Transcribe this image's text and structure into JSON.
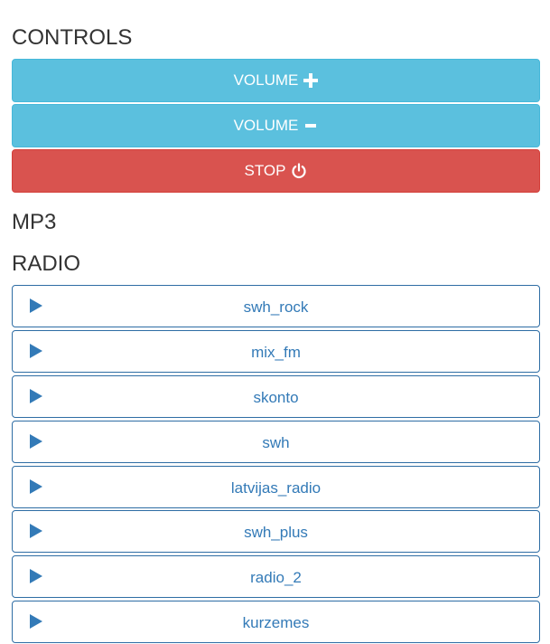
{
  "controls": {
    "heading": "CONTROLS",
    "volume_up_label": "VOLUME",
    "volume_down_label": "VOLUME",
    "stop_label": "STOP"
  },
  "mp3": {
    "heading": "MP3"
  },
  "radio": {
    "heading": "RADIO",
    "stations": [
      "swh_rock",
      "mix_fm",
      "skonto",
      "swh",
      "latvijas_radio",
      "swh_plus",
      "radio_2",
      "kurzemes"
    ]
  },
  "colors": {
    "info": "#5bc0de",
    "danger": "#d9534f",
    "primary_border": "#2e6da4",
    "link_text": "#337ab7"
  }
}
